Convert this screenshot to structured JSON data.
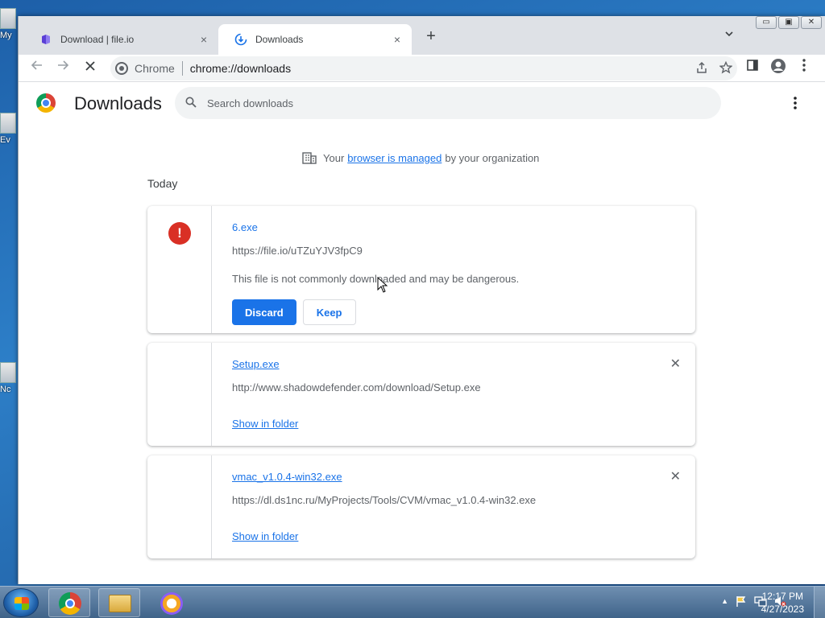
{
  "browser": {
    "tabs": [
      {
        "title": "Download | file.io",
        "close": "×"
      },
      {
        "title": "Downloads",
        "close": "×"
      }
    ],
    "new_tab": "+",
    "window_controls": {
      "minimize": "▭",
      "maximize": "▣",
      "close": "✕"
    },
    "address": {
      "site_chip": "Chrome",
      "url": "chrome://downloads"
    }
  },
  "downloads_page": {
    "title": "Downloads",
    "search_placeholder": "Search downloads",
    "managed_notice": {
      "prefix": "Your",
      "link": "browser is managed",
      "suffix": "by your organization"
    },
    "section": "Today",
    "items": [
      {
        "name": "6.exe",
        "url": "https://file.io/uTZuYJV3fpC9",
        "warning": "This file is not commonly downloaded and may be dangerous.",
        "discard_label": "Discard",
        "keep_label": "Keep",
        "warning_glyph": "!"
      },
      {
        "name": "Setup.exe",
        "url": "http://www.shadowdefender.com/download/Setup.exe",
        "action": "Show in folder",
        "remove_glyph": "✕"
      },
      {
        "name": "vmac_v1.0.4-win32.exe",
        "url": "https://dl.ds1nc.ru/MyProjects/Tools/CVM/vmac_v1.0.4-win32.exe",
        "action": "Show in folder",
        "remove_glyph": "✕"
      }
    ]
  },
  "desktop": {
    "icon_labels": [
      "My",
      "Ev",
      "Nc"
    ]
  },
  "taskbar": {
    "clock_time": "12:17 PM",
    "clock_date": "4/27/2023",
    "tray_expand": "▲"
  },
  "colors": {
    "accent": "#1a73e8",
    "danger": "#d93025"
  }
}
